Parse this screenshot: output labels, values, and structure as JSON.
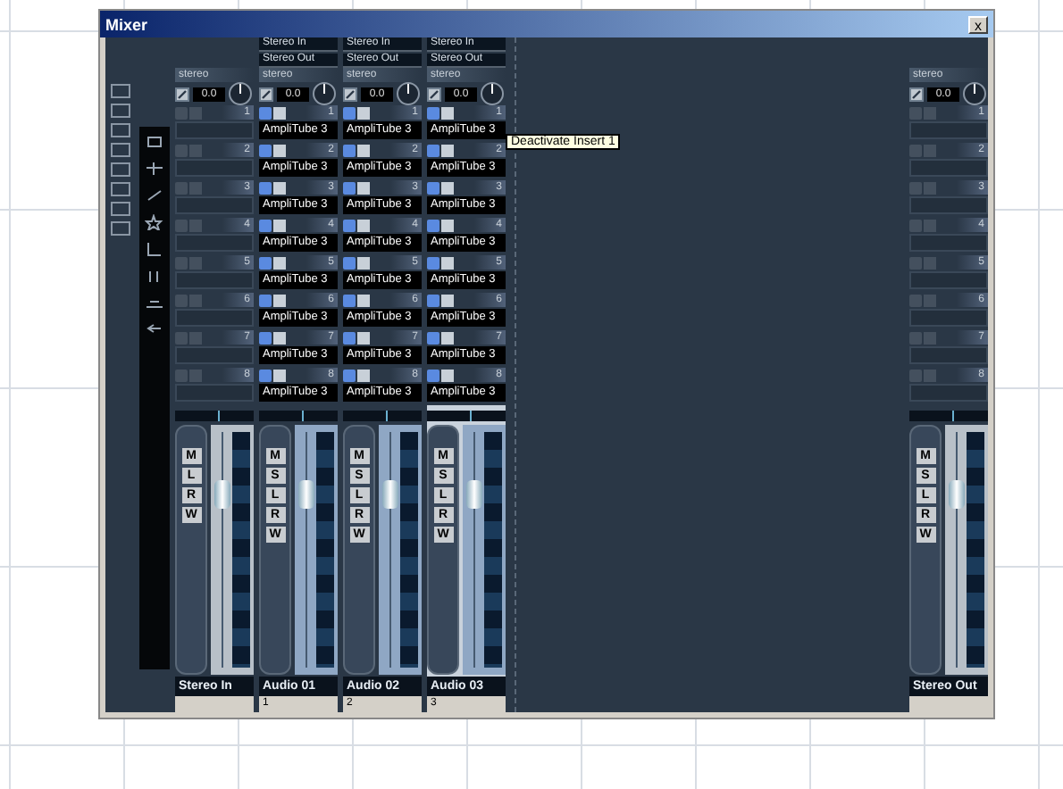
{
  "window": {
    "title": "Mixer",
    "close": "x"
  },
  "channels": [
    {
      "name": "Stereo In",
      "selected": false,
      "label": "stereo",
      "pan": "0.0",
      "buttons": [
        "M",
        "L",
        "R",
        "W"
      ],
      "level": 0.78,
      "inserts": [
        {
          "slot": "1",
          "active": false
        },
        {
          "slot": "2",
          "active": false
        },
        {
          "slot": "3",
          "active": false
        },
        {
          "slot": "4",
          "active": false
        },
        {
          "slot": "5",
          "active": false
        },
        {
          "slot": "6",
          "active": false
        },
        {
          "slot": "7",
          "active": false
        },
        {
          "slot": "8",
          "active": false
        }
      ]
    },
    {
      "name": "Audio 01",
      "number": "1",
      "selected": false,
      "routing": [
        "Stereo In",
        "Stereo Out"
      ],
      "label": "stereo",
      "pan": "0.0",
      "buttons": [
        "M",
        "S",
        "L",
        "R",
        "W"
      ],
      "level": 0.78,
      "inserts": [
        {
          "slot": "1",
          "name": "AmpliTube 3",
          "active": true
        },
        {
          "slot": "2",
          "name": "AmpliTube 3",
          "active": true
        },
        {
          "slot": "3",
          "name": "AmpliTube 3",
          "active": true
        },
        {
          "slot": "4",
          "name": "AmpliTube 3",
          "active": true
        },
        {
          "slot": "5",
          "name": "AmpliTube 3",
          "active": true
        },
        {
          "slot": "6",
          "name": "AmpliTube 3",
          "active": true
        },
        {
          "slot": "7",
          "name": "AmpliTube 3",
          "active": true
        },
        {
          "slot": "8",
          "name": "AmpliTube 3",
          "active": true
        }
      ]
    },
    {
      "name": "Audio 02",
      "number": "2",
      "selected": false,
      "routing": [
        "Stereo In",
        "Stereo Out"
      ],
      "label": "stereo",
      "pan": "0.0",
      "buttons": [
        "M",
        "S",
        "L",
        "R",
        "W"
      ],
      "level": 0.78,
      "inserts": [
        {
          "slot": "1",
          "name": "AmpliTube 3",
          "active": true
        },
        {
          "slot": "2",
          "name": "AmpliTube 3",
          "active": true
        },
        {
          "slot": "3",
          "name": "AmpliTube 3",
          "active": true
        },
        {
          "slot": "4",
          "name": "AmpliTube 3",
          "active": true
        },
        {
          "slot": "5",
          "name": "AmpliTube 3",
          "active": true
        },
        {
          "slot": "6",
          "name": "AmpliTube 3",
          "active": true
        },
        {
          "slot": "7",
          "name": "AmpliTube 3",
          "active": true
        },
        {
          "slot": "8",
          "name": "AmpliTube 3",
          "active": true
        }
      ]
    },
    {
      "name": "Audio 03",
      "number": "3",
      "selected": true,
      "routing": [
        "Stereo In",
        "Stereo Out"
      ],
      "label": "stereo",
      "pan": "0.0",
      "buttons": [
        "M",
        "S",
        "L",
        "R",
        "W"
      ],
      "level": 0.78,
      "inserts": [
        {
          "slot": "1",
          "name": "AmpliTube 3",
          "active": true,
          "tooltip": "Deactivate Insert 1"
        },
        {
          "slot": "2",
          "name": "AmpliTube 3",
          "active": true
        },
        {
          "slot": "3",
          "name": "AmpliTube 3",
          "active": true
        },
        {
          "slot": "4",
          "name": "AmpliTube 3",
          "active": true
        },
        {
          "slot": "5",
          "name": "AmpliTube 3",
          "active": true
        },
        {
          "slot": "6",
          "name": "AmpliTube 3",
          "active": true
        },
        {
          "slot": "7",
          "name": "AmpliTube 3",
          "active": true
        },
        {
          "slot": "8",
          "name": "AmpliTube 3",
          "active": true
        }
      ]
    },
    {
      "name": "Stereo Out",
      "selected": false,
      "label": "stereo",
      "pan": "0.0",
      "buttons": [
        "M",
        "S",
        "L",
        "R",
        "W"
      ],
      "level": 0.78,
      "inserts": [
        {
          "slot": "1",
          "active": false
        },
        {
          "slot": "2",
          "active": false
        },
        {
          "slot": "3",
          "active": false
        },
        {
          "slot": "4",
          "active": false
        },
        {
          "slot": "5",
          "active": false
        },
        {
          "slot": "6",
          "active": false
        },
        {
          "slot": "7",
          "active": false
        },
        {
          "slot": "8",
          "active": false
        }
      ]
    }
  ]
}
